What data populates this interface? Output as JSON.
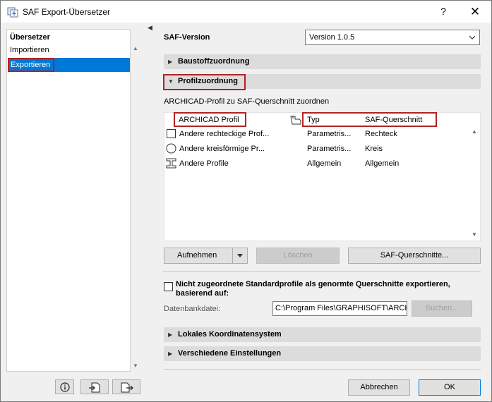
{
  "window": {
    "title": "SAF Export-Übersetzer",
    "help": "?",
    "close": "✕"
  },
  "sidebar": {
    "header": "Übersetzer",
    "items": [
      {
        "label": "Importieren"
      },
      {
        "label": "Exportieren"
      }
    ]
  },
  "main": {
    "saf_version_label": "SAF-Version",
    "saf_version_value": "Version 1.0.5",
    "section_material": "Baustoffzuordnung",
    "section_profile": "Profilzuordnung",
    "profile_description": "ARCHICAD-Profil zu SAF-Querschnitt zuordnen",
    "table": {
      "headers": [
        "ARCHICAD Profil",
        "Typ",
        "SAF-Querschnitt"
      ],
      "rows": [
        {
          "icon": "rectangle-profile-icon",
          "name": "Andere rechteckige Prof...",
          "type": "Parametris...",
          "saf": "Rechteck"
        },
        {
          "icon": "circle-profile-icon",
          "name": "Andere kreisförmige Pr...",
          "type": "Parametris...",
          "saf": "Kreis"
        },
        {
          "icon": "i-beam-profile-icon",
          "name": "Andere Profile",
          "type": "Allgemein",
          "saf": "Allgemein"
        }
      ]
    },
    "btn_add": "Aufnehmen",
    "btn_delete": "Löschen",
    "btn_sections": "SAF-Querschnitte...",
    "checkbox_label_1": "Nicht zugeordnete Standardprofile als genormte Querschnitte exportieren,",
    "checkbox_label_2": "basierend auf:",
    "db_label": "Datenbankdatei:",
    "db_value": "C:\\Program Files\\GRAPHISOFT\\ARCHICAD",
    "btn_search": "Suchen...",
    "section_coords": "Lokales Koordinatensystem",
    "section_misc": "Verschiedene Einstellungen"
  },
  "footer": {
    "cancel": "Abbrechen",
    "ok": "OK"
  },
  "colors": {
    "selection": "#0078d7",
    "highlight": "#b22222"
  }
}
